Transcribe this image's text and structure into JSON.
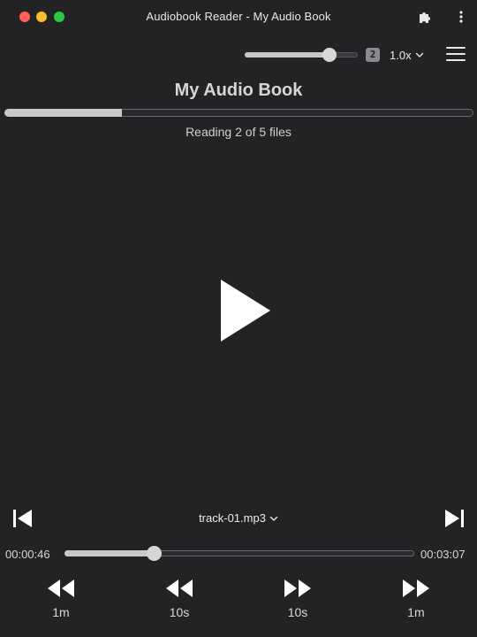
{
  "window": {
    "title": "Audiobook Reader - My Audio Book"
  },
  "toolbar": {
    "volume": 0.75,
    "badge_label": "2",
    "speed_label": "1.0x"
  },
  "book": {
    "title": "My Audio Book",
    "progress": 0.25,
    "status": "Reading 2 of 5 files"
  },
  "track": {
    "current_file": "track-01.mp3"
  },
  "seek": {
    "elapsed": "00:00:46",
    "total": "00:03:07",
    "position": 0.255
  },
  "skip_controls": [
    {
      "label": "1m",
      "icon": "rewind-icon"
    },
    {
      "label": "10s",
      "icon": "rewind-icon"
    },
    {
      "label": "10s",
      "icon": "fast-forward-icon"
    },
    {
      "label": "1m",
      "icon": "fast-forward-icon"
    }
  ],
  "colors": {
    "background": "#232326",
    "accent": "#c9c9cc",
    "close": "#fe5f57",
    "minimize": "#febc2e",
    "maximize": "#28c840"
  }
}
